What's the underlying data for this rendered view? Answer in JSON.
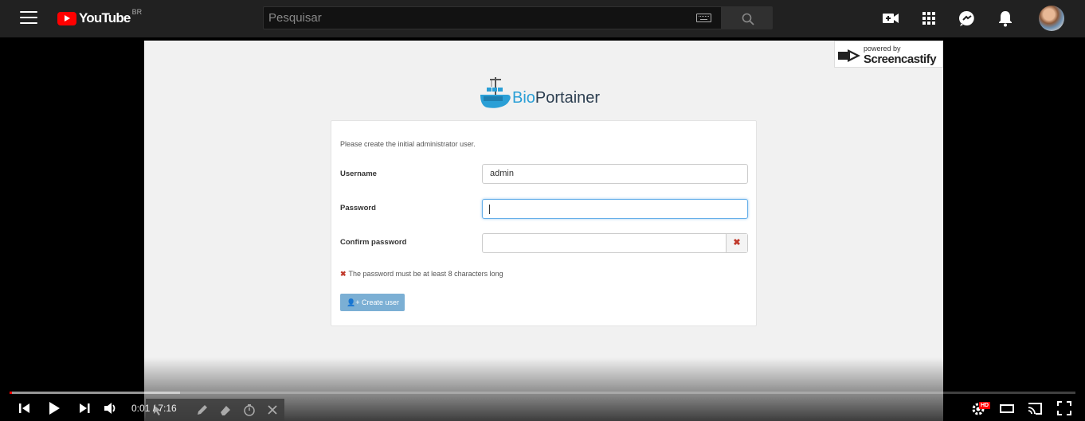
{
  "header": {
    "menu_icon": "hamburger-menu-icon",
    "logo_text": "YouTube",
    "country_code": "BR",
    "search_placeholder": "Pesquisar",
    "icons": [
      "create-video-icon",
      "apps-grid-icon",
      "messages-icon",
      "notifications-bell-icon"
    ]
  },
  "video_frame": {
    "watermark": {
      "small": "powered by",
      "big": "Screencastify"
    },
    "app_logo": {
      "bio": "Bio",
      "rest": "Portainer"
    },
    "form": {
      "intro": "Please create the initial administrator user.",
      "username_label": "Username",
      "username_value": "admin",
      "password_label": "Password",
      "password_value": "",
      "confirm_label": "Confirm password",
      "confirm_value": "",
      "error_message": "The password must be at least 8 characters long",
      "create_button": "Create user"
    }
  },
  "player": {
    "time": "0:01 / 7:16",
    "played_fraction": 0.002,
    "buffered_fraction": 0.16,
    "quality_badge": "HD"
  },
  "colors": {
    "header_bg": "#212121",
    "youtube_red": "#ff0000",
    "bio_blue": "#2a9fd6",
    "button_blue": "#7bafd4",
    "error_red": "#c0392b"
  }
}
